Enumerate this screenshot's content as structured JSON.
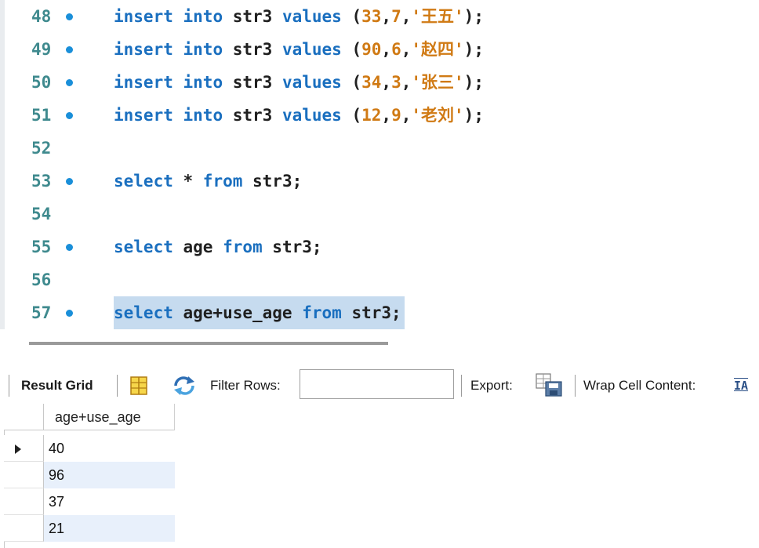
{
  "editor": {
    "lines": [
      {
        "no": "48",
        "dot": true,
        "tokens": [
          {
            "t": "insert",
            "c": "kw"
          },
          {
            "t": " "
          },
          {
            "t": "into",
            "c": "kw"
          },
          {
            "t": " str3 "
          },
          {
            "t": "values",
            "c": "kw"
          },
          {
            "t": " ("
          },
          {
            "t": "33",
            "c": "num"
          },
          {
            "t": ","
          },
          {
            "t": "7",
            "c": "num"
          },
          {
            "t": ","
          },
          {
            "t": "'王五'",
            "c": "str"
          },
          {
            "t": ");"
          }
        ]
      },
      {
        "no": "49",
        "dot": true,
        "tokens": [
          {
            "t": "insert",
            "c": "kw"
          },
          {
            "t": " "
          },
          {
            "t": "into",
            "c": "kw"
          },
          {
            "t": " str3 "
          },
          {
            "t": "values",
            "c": "kw"
          },
          {
            "t": " ("
          },
          {
            "t": "90",
            "c": "num"
          },
          {
            "t": ","
          },
          {
            "t": "6",
            "c": "num"
          },
          {
            "t": ","
          },
          {
            "t": "'赵四'",
            "c": "str"
          },
          {
            "t": ");"
          }
        ]
      },
      {
        "no": "50",
        "dot": true,
        "tokens": [
          {
            "t": "insert",
            "c": "kw"
          },
          {
            "t": " "
          },
          {
            "t": "into",
            "c": "kw"
          },
          {
            "t": " str3 "
          },
          {
            "t": "values",
            "c": "kw"
          },
          {
            "t": " ("
          },
          {
            "t": "34",
            "c": "num"
          },
          {
            "t": ","
          },
          {
            "t": "3",
            "c": "num"
          },
          {
            "t": ","
          },
          {
            "t": "'张三'",
            "c": "str"
          },
          {
            "t": ");"
          }
        ]
      },
      {
        "no": "51",
        "dot": true,
        "tokens": [
          {
            "t": "insert",
            "c": "kw"
          },
          {
            "t": " "
          },
          {
            "t": "into",
            "c": "kw"
          },
          {
            "t": " str3 "
          },
          {
            "t": "values",
            "c": "kw"
          },
          {
            "t": " ("
          },
          {
            "t": "12",
            "c": "num"
          },
          {
            "t": ","
          },
          {
            "t": "9",
            "c": "num"
          },
          {
            "t": ","
          },
          {
            "t": "'老刘'",
            "c": "str"
          },
          {
            "t": ");"
          }
        ]
      },
      {
        "no": "52",
        "dot": false,
        "tokens": []
      },
      {
        "no": "53",
        "dot": true,
        "tokens": [
          {
            "t": "select",
            "c": "kw"
          },
          {
            "t": " * "
          },
          {
            "t": "from",
            "c": "kw"
          },
          {
            "t": " str3;"
          }
        ]
      },
      {
        "no": "54",
        "dot": false,
        "tokens": []
      },
      {
        "no": "55",
        "dot": true,
        "tokens": [
          {
            "t": "select",
            "c": "kw"
          },
          {
            "t": " age "
          },
          {
            "t": "from",
            "c": "kw"
          },
          {
            "t": " str3;"
          }
        ]
      },
      {
        "no": "56",
        "dot": false,
        "tokens": []
      },
      {
        "no": "57",
        "dot": true,
        "selected": true,
        "tokens": [
          {
            "t": "select",
            "c": "kw"
          },
          {
            "t": " age+use_age "
          },
          {
            "t": "from",
            "c": "kw"
          },
          {
            "t": " str3;"
          }
        ]
      }
    ]
  },
  "toolbar": {
    "result_grid_label": "Result Grid",
    "filter_rows_label": "Filter Rows:",
    "filter_value": "",
    "export_label": "Export:",
    "wrap_label": "Wrap Cell Content:",
    "wrap_icon_glyph": "IA"
  },
  "grid": {
    "column": "age+use_age",
    "rows": [
      "40",
      "96",
      "37",
      "21"
    ]
  },
  "colors": {
    "keyword": "#1a6fbf",
    "number": "#d07a14",
    "line_number": "#3f8a8e",
    "selection": "#c6dbef",
    "row_alt": "#e8f0fb"
  }
}
